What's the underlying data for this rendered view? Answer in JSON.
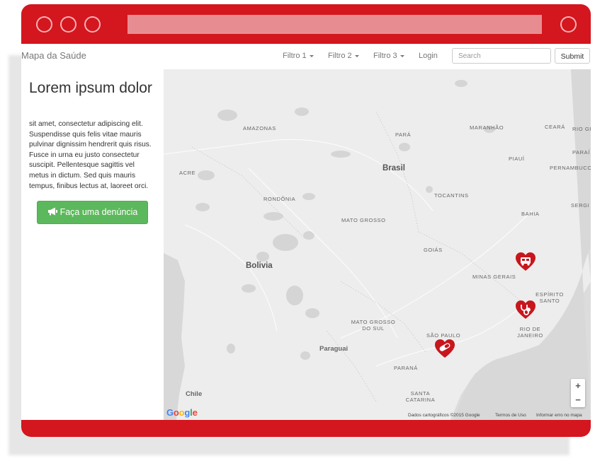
{
  "colors": {
    "frame": "#d4161e",
    "button_green": "#5cb85c",
    "marker": "#c8161d"
  },
  "navbar": {
    "brand": "Mapa da Saúde",
    "filters": [
      "Filtro 1",
      "Filtro 2",
      "Filtro 3"
    ],
    "login": "Login",
    "search_placeholder": "Search",
    "submit_label": "Submit"
  },
  "sidebar": {
    "title": "Lorem ipsum dolor",
    "text": "sit amet, consectetur adipiscing elit. Suspendisse quis felis vitae mauris pulvinar dignissim hendrerit quis risus. Fusce in urna eu justo consectetur suscipit. Pellentesque sagittis vel metus in dictum. Sed quis mauris tempus, finibus lectus at, laoreet orci.",
    "report_button": "Faça uma denúncia",
    "report_icon": "megaphone-icon"
  },
  "map": {
    "labels": {
      "amazonas": "AMAZONAS",
      "para": "PARÁ",
      "maranhao": "MARANHÃO",
      "ceara": "CEARÁ",
      "rio_grande": "RIO GR",
      "paraiba": "PARAÍ",
      "piaui": "PIAUÍ",
      "pernambuco": "PERNAMBUCO",
      "acre": "ACRE",
      "brasil": "Brasil",
      "tocantins": "TOCANTINS",
      "rondonia": "RONDÔNIA",
      "bahia": "BAHIA",
      "sergipe": "SERGI",
      "mato_grosso": "MATO GROSSO",
      "goias": "GOIÁS",
      "bolivia": "Bolivia",
      "minas_gerais": "MINAS GERAIS",
      "espirito_santo": "ESPÍRITO SANTO",
      "rio_de_janeiro": "RIO DE JANEIRO",
      "mato_grosso_do_sul": "MATO GROSSO DO SUL",
      "sao_paulo": "SÃO PAULO",
      "paraguai": "Paraguai",
      "parana": "PARANÁ",
      "chile": "Chile",
      "santa_catarina": "SANTA CATARINA"
    },
    "markers": [
      {
        "name": "ambulance-marker",
        "icon": "ambulance-icon"
      },
      {
        "name": "stethoscope-marker",
        "icon": "stethoscope-icon"
      },
      {
        "name": "pill-marker",
        "icon": "pill-icon"
      }
    ],
    "zoom_in": "+",
    "zoom_out": "−",
    "google_logo": "Google",
    "attribution": "Dados cartográficos ©2015 Google",
    "terms": "Termos de Uso",
    "report_error": "Informar erro no mapa"
  }
}
